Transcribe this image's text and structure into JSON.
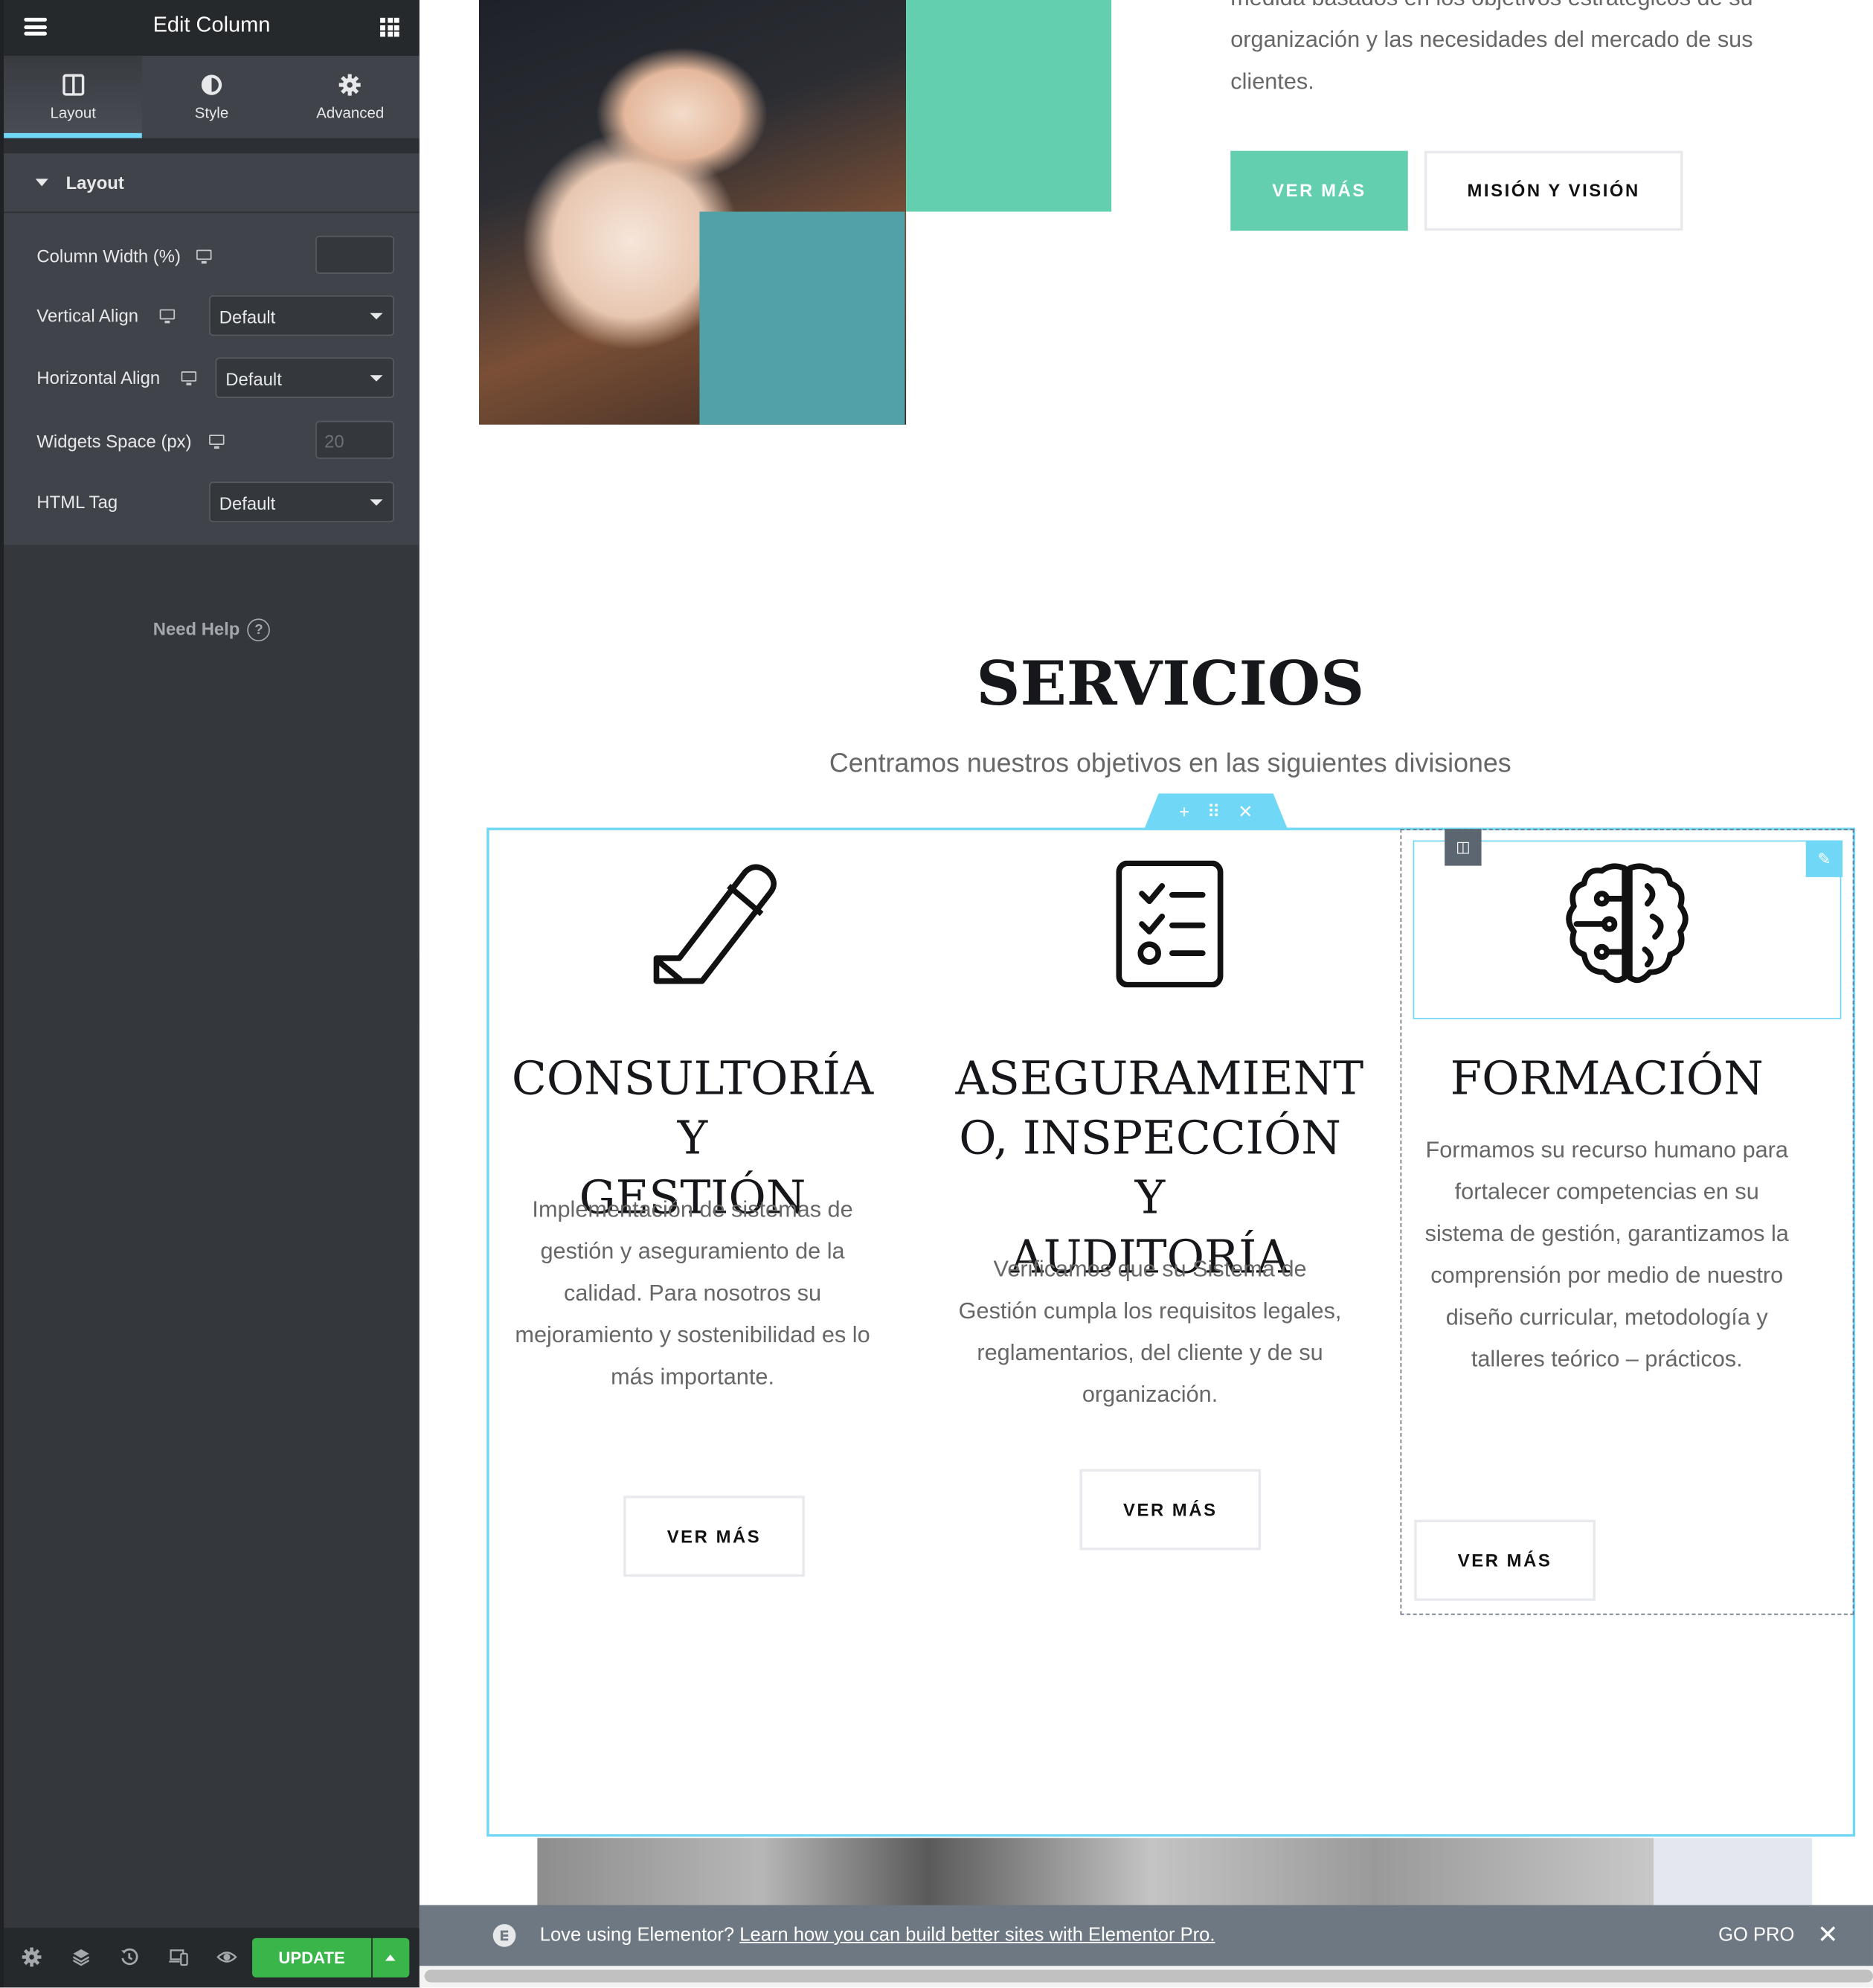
{
  "panel": {
    "title": "Edit Column",
    "menu_icon": "hamburger-icon",
    "apps_icon": "apps-grid-icon",
    "tabs": [
      {
        "label": "Layout",
        "icon": "columns-icon",
        "active": true
      },
      {
        "label": "Style",
        "icon": "half-circle-icon",
        "active": false
      },
      {
        "label": "Advanced",
        "icon": "gear-icon",
        "active": false
      }
    ],
    "section_title": "Layout",
    "controls": {
      "column_width": {
        "label": "Column Width (%)",
        "value": ""
      },
      "vertical_align": {
        "label": "Vertical Align",
        "value": "Default"
      },
      "horizontal_align": {
        "label": "Horizontal Align",
        "value": "Default"
      },
      "widgets_space": {
        "label": "Widgets Space (px)",
        "placeholder": "20"
      },
      "html_tag": {
        "label": "HTML Tag",
        "value": "Default"
      }
    },
    "help_label": "Need Help",
    "footer": {
      "icons": [
        "settings-icon",
        "navigator-layers-icon",
        "history-icon",
        "responsive-mode-icon",
        "preview-eye-icon"
      ],
      "update_label": "UPDATE"
    }
  },
  "colors": {
    "accent": "#71d7f7",
    "brand_teal_light": "#64cfae",
    "brand_teal_dark": "#50a2a8",
    "update_green": "#39b54a",
    "panel_bg": "#404349",
    "promo_bg": "#6d7882"
  },
  "about": {
    "text_cutoff": "medida basados en los objetivos estratégicos de su",
    "text": "organización y las necesidades del mercado de sus clientes.",
    "btn_primary": "VER MÁS",
    "btn_secondary": "MISIÓN Y VISIÓN"
  },
  "services": {
    "title": "SERVICIOS",
    "subtitle": "Centramos nuestros objetivos en las siguientes divisiones",
    "section_handle": {
      "add": "+",
      "drag": "⠿",
      "close": "✕"
    },
    "items": [
      {
        "icon": "pencil-icon",
        "heading_lines": [
          "CONSULTORÍA Y",
          "GESTIÓN"
        ],
        "text": "Implementación de sistemas de gestión y aseguramiento de la calidad. Para nosotros su mejoramiento y sostenibilidad es lo más importante.",
        "button": "VER MÁS"
      },
      {
        "icon": "checklist-icon",
        "heading_lines": [
          "ASEGURAMIENT",
          "O, INSPECCIÓN Y",
          "AUDITORÍA"
        ],
        "text": "Verificamos que su Sistema de Gestión cumpla los requisitos legales, reglamentarios, del cliente y de su organización.",
        "button": "VER MÁS"
      },
      {
        "icon": "brain-circuit-icon",
        "heading_lines": [
          "FORMACIÓN"
        ],
        "text": "Formamos su recurso humano para fortalecer competencias en su sistema de gestión, garantizamos la comprensión por medio de nuestro diseño curricular, metodología y talleres teórico – prácticos.",
        "button": "VER MÁS"
      }
    ]
  },
  "promo": {
    "lead": "Love using Elementor?",
    "link": "Learn how you can build better sites with Elementor Pro.",
    "go_pro": "GO PRO"
  }
}
